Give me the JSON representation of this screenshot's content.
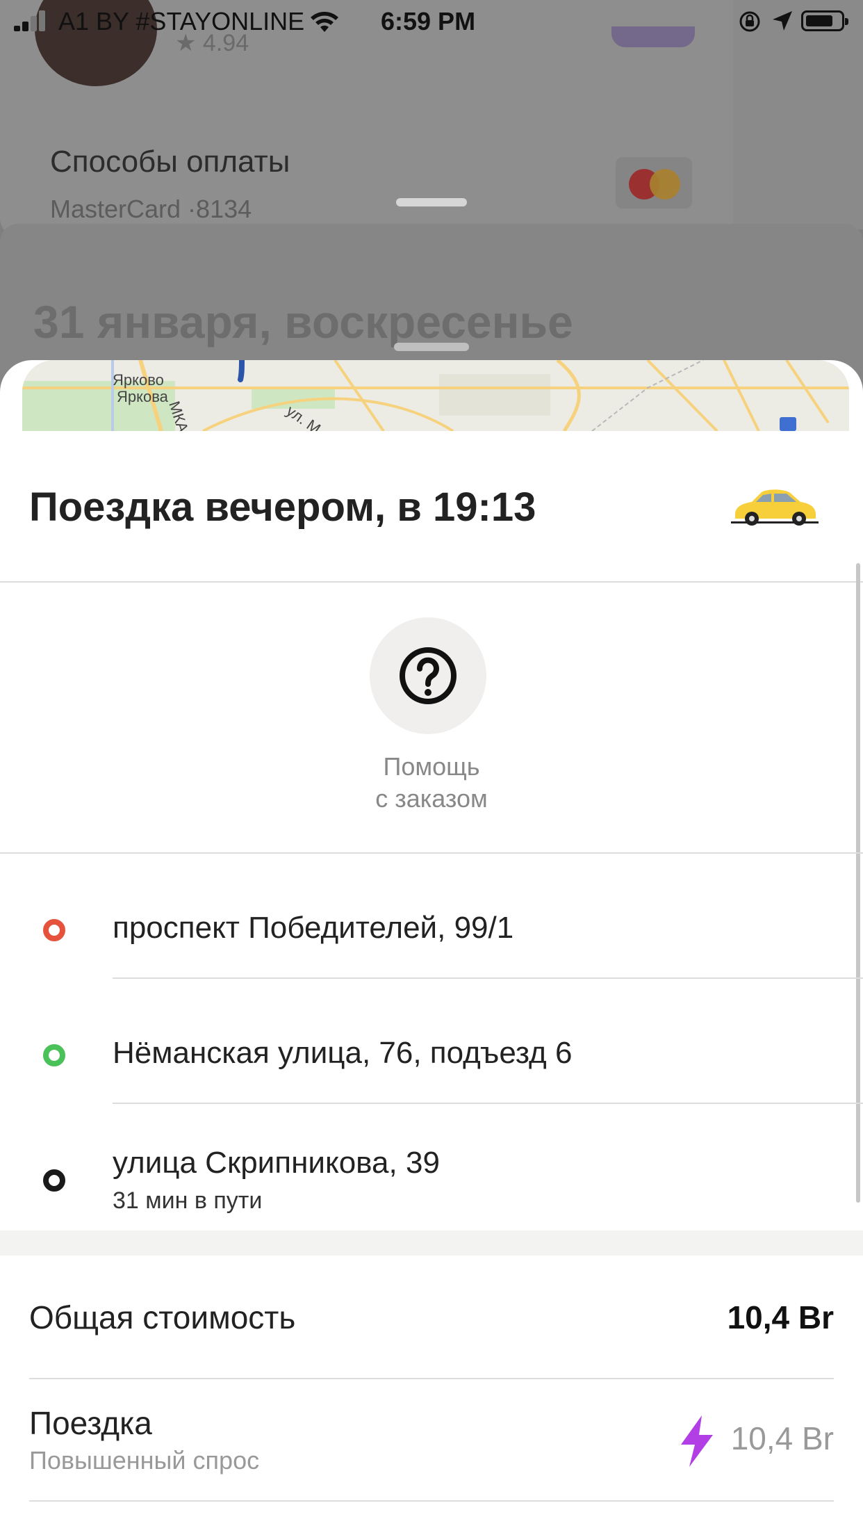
{
  "status_bar": {
    "carrier": "A1 BY #STAYONLINE",
    "time": "6:59 PM"
  },
  "background": {
    "rating": "★ 4.94",
    "payment_title": "Способы оплаты",
    "payment_card": "MasterCard ·8134",
    "date_title": "31 января, воскресенье"
  },
  "map": {
    "labels": [
      "Ярково",
      "Яркова",
      "МКАД",
      "ул. М"
    ]
  },
  "trip": {
    "title": "Поездка вечером, в 19:13",
    "help_label_line1": "Помощь",
    "help_label_line2": "с заказом",
    "route": [
      {
        "address": "проспект Победителей, 99/1",
        "color": "#e5533c"
      },
      {
        "address": "Нёманская улица, 76, подъезд 6",
        "color": "#4bc159"
      },
      {
        "address": "улица Скрипникова, 39",
        "sub": "31 мин в пути",
        "color": "#1a1a1a"
      }
    ]
  },
  "cost": {
    "total_label": "Общая стоимость",
    "total_value": "10,4 Br",
    "ride_label": "Поездка",
    "ride_sub": "Повышенный спрос",
    "ride_value": "10,4 Br",
    "surge_color": "#b23fe6"
  }
}
